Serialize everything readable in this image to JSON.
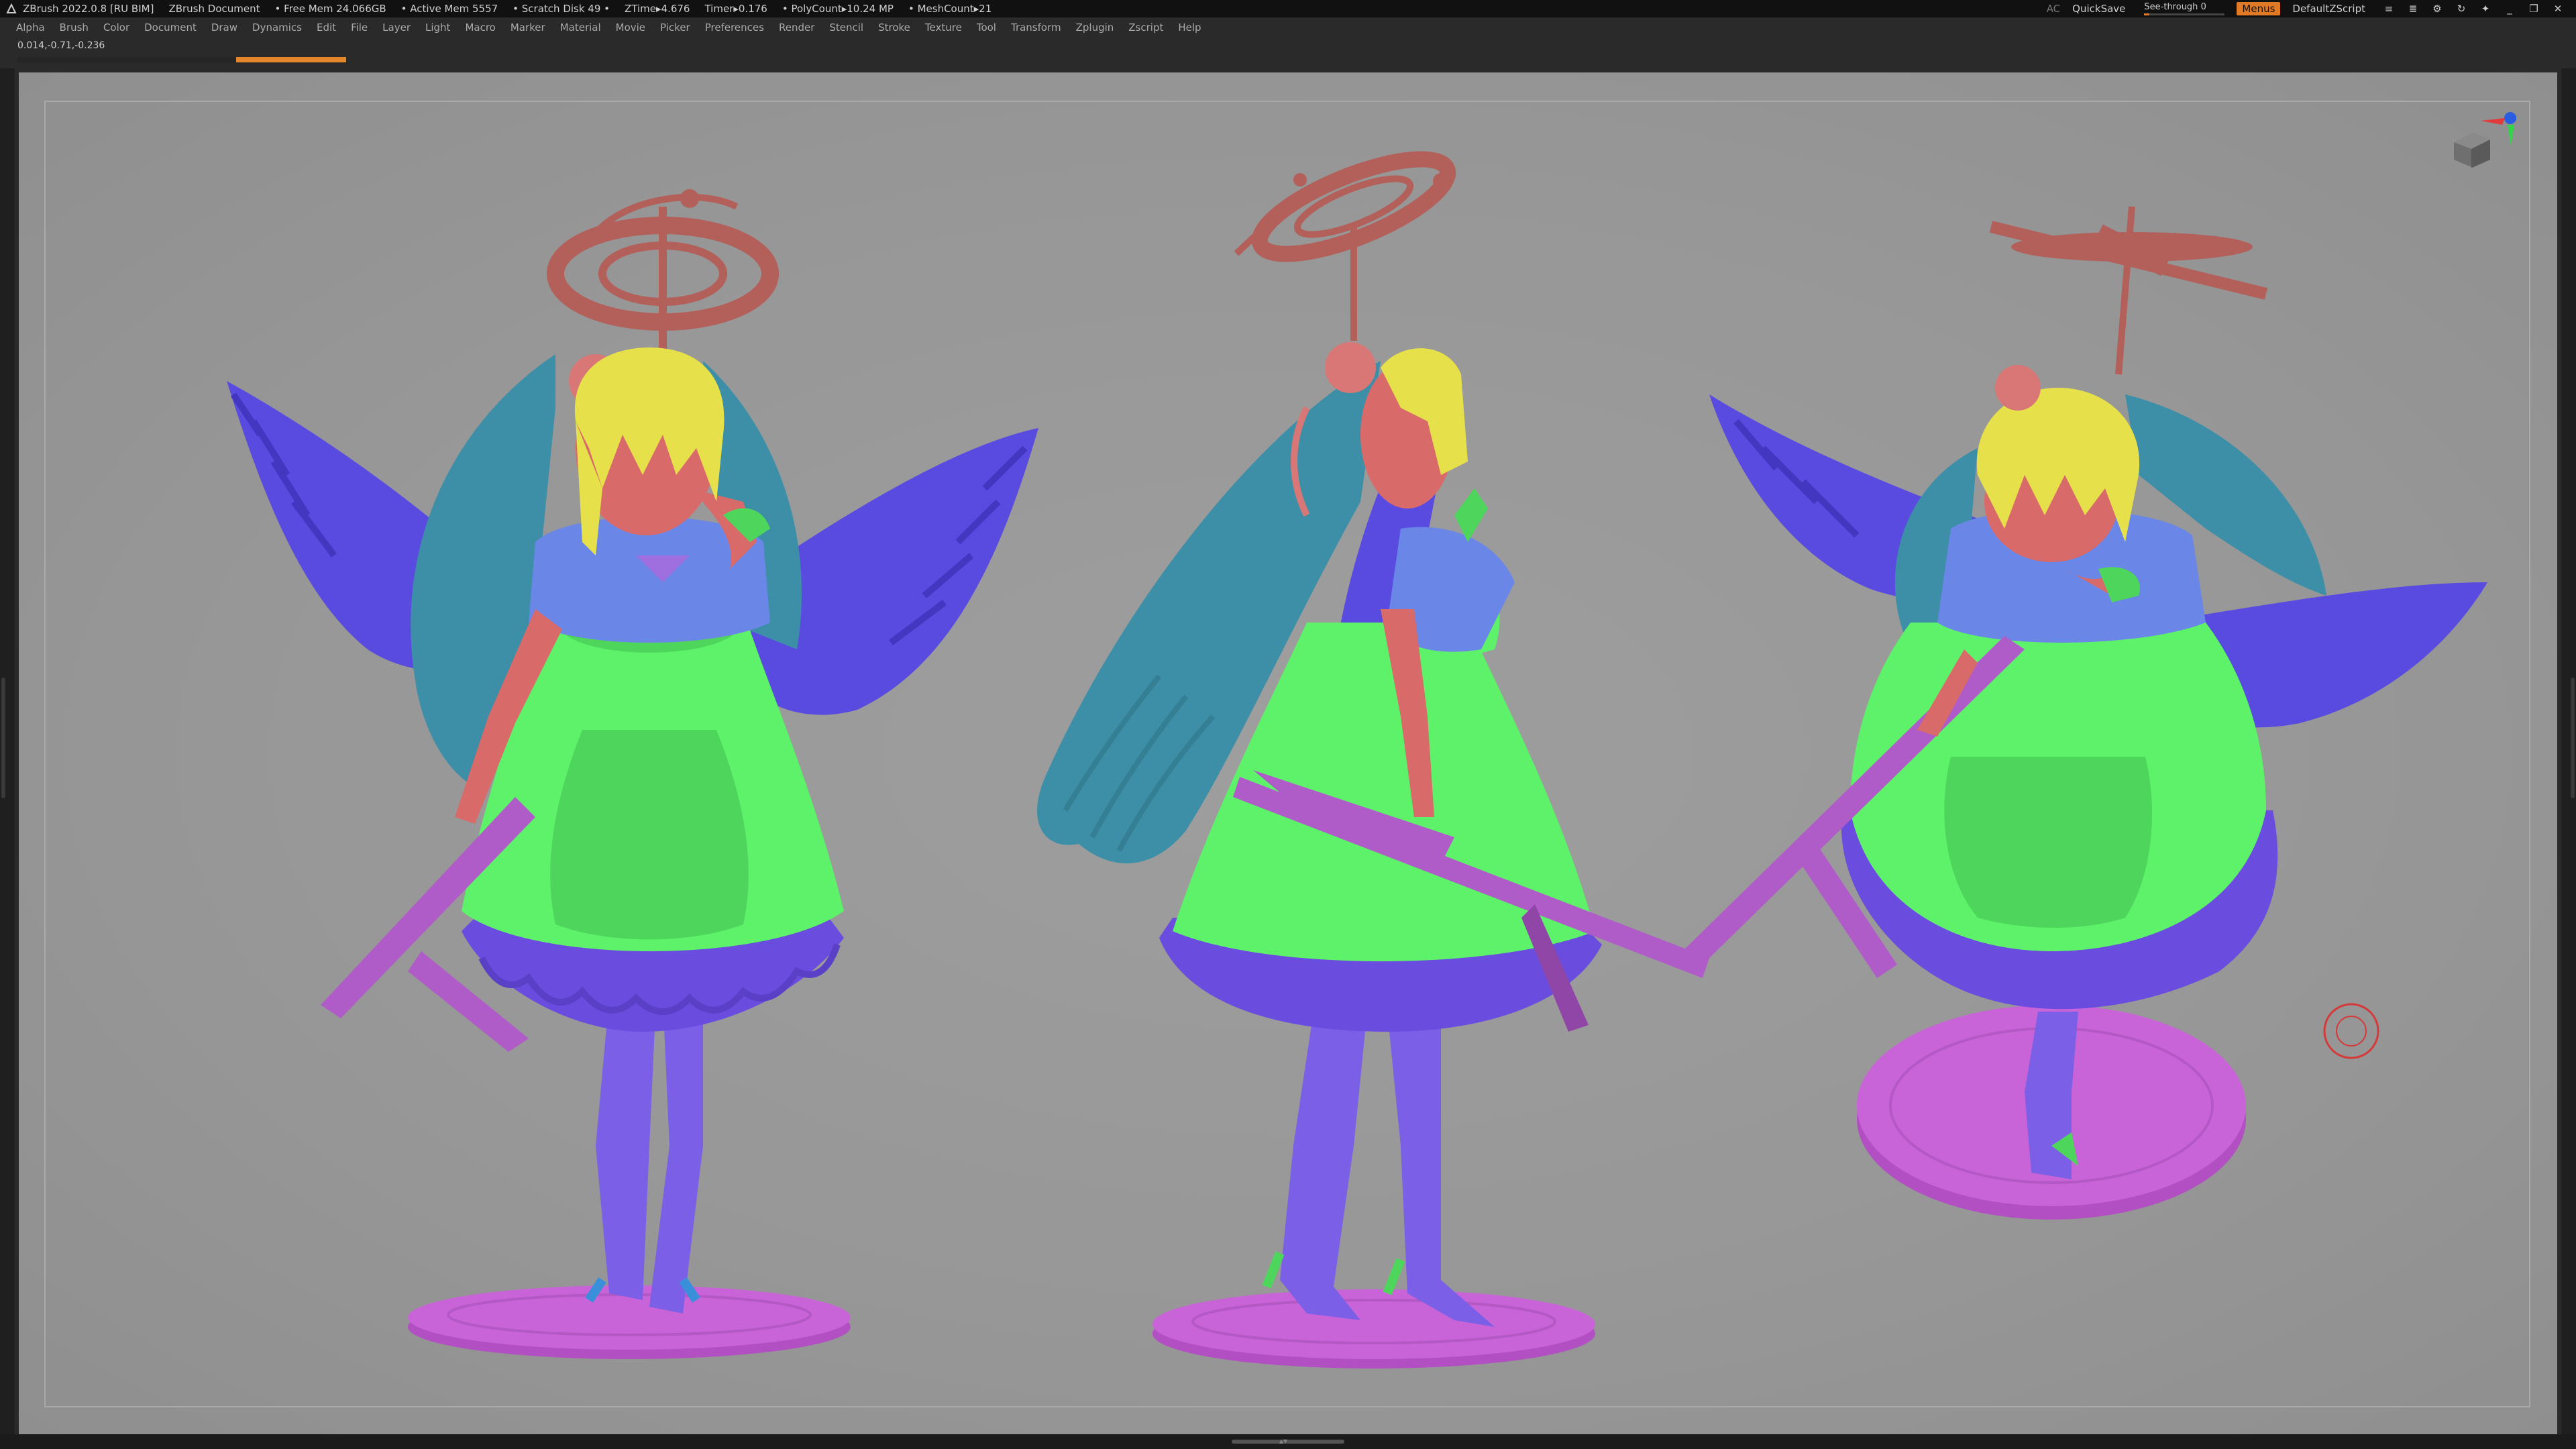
{
  "titlebar": {
    "app": "ZBrush 2022.0.8 [RU BIM]",
    "document": "ZBrush Document",
    "free_mem": "• Free Mem 24.066GB",
    "active_mem": "• Active Mem 5557",
    "scratch_disk": "• Scratch Disk 49 •",
    "ztime": "ZTime▸4.676",
    "timer": "Timer▸0.176",
    "polycount": "• PolyCount▸10.24 MP",
    "meshcount": "• MeshCount▸21",
    "ac": "AC",
    "quicksave": "QuickSave",
    "see_through_label": "See-through",
    "see_through_value": "0",
    "menus": "Menus",
    "default_script": "DefaultZScript"
  },
  "menubar": {
    "items": [
      "Alpha",
      "Brush",
      "Color",
      "Document",
      "Draw",
      "Dynamics",
      "Edit",
      "File",
      "Layer",
      "Light",
      "Macro",
      "Marker",
      "Material",
      "Movie",
      "Picker",
      "Preferences",
      "Render",
      "Stencil",
      "Stroke",
      "Texture",
      "Tool",
      "Transform",
      "Zplugin",
      "Zscript",
      "Help"
    ]
  },
  "info": {
    "coordinates": "0.014,-0.71,-0.236",
    "progress_fraction": 0.33
  },
  "icons": {
    "logo": "zbrush-logo-icon",
    "gizmo": "navigation-cube-icon",
    "cursor": "brush-cursor-icon"
  },
  "colors": {
    "accent": "#e07a26",
    "hair": "#3d8fa8",
    "skin": "#d96a6a",
    "dress": "#5ef26a",
    "skirt": "#6a4cdf",
    "wings": "#5a4be0",
    "stockings": "#7b5fe6",
    "base": "#c964d8",
    "halo": "#b35f5a",
    "bangs": "#e6e04a",
    "gun": "#b05cc8",
    "canvas": "#979797"
  }
}
